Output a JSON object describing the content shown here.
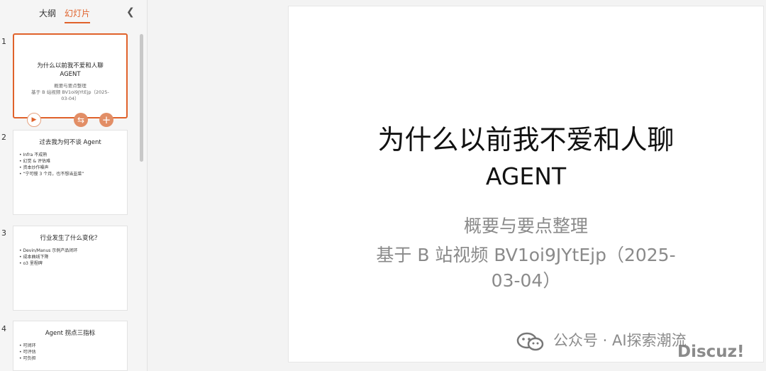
{
  "sidebar": {
    "tabs": [
      "大纲",
      "幻灯片"
    ],
    "slides": [
      {
        "num": "1",
        "title": "为什么以前我不爱和人聊",
        "title2": "AGENT",
        "sub1": "概要与要点整理",
        "sub2": "基于 B 站视频 BV1oi9JYtEjp（2025-",
        "sub3": "03-04）"
      },
      {
        "num": "2",
        "title": "过去我为何不谈 Agent",
        "bullets": [
          "Infra 不成熟",
          "幻觉 & 评估难",
          "资本炒作噪声",
          "“宁可慢 3 个月，也不想当韭菜”"
        ]
      },
      {
        "num": "3",
        "title": "行业发生了什么变化？",
        "bullets": [
          "Devin/Manus 示例产品闭环",
          "成本曲线下降",
          "o3 里程碑"
        ]
      },
      {
        "num": "4",
        "title": "Agent 拐点三指标",
        "bullets": [
          "可闭环",
          "可评估",
          "可负担"
        ]
      }
    ]
  },
  "slide": {
    "title_line1": "为什么以前我不爱和人聊",
    "title_line2": "AGENT",
    "subtitle_line1": "概要与要点整理",
    "subtitle_line2": "基于 B 站视频 BV1oi9JYtEjp（2025-",
    "subtitle_line3": "03-04）"
  },
  "overlay": {
    "watermark": "公众号 · AI探索潮流",
    "discuz": "Discuz!"
  },
  "icons": [
    "chevron-left-icon",
    "play-icon",
    "shuffle-icon",
    "plus-icon",
    "wechat-icon"
  ],
  "colors": {
    "accent": "#e0622b"
  }
}
